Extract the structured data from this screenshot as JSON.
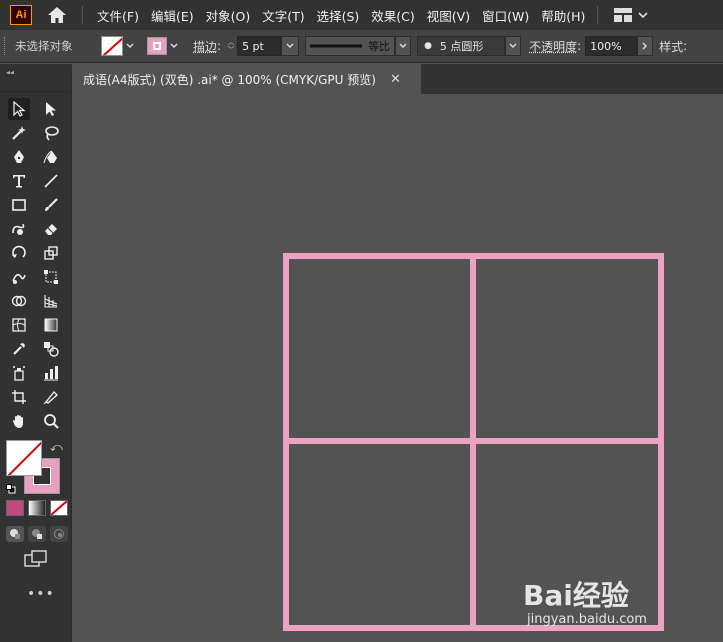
{
  "app": {
    "logo_text": "Ai"
  },
  "menu": {
    "items": [
      {
        "label": "文件(F)"
      },
      {
        "label": "编辑(E)"
      },
      {
        "label": "对象(O)"
      },
      {
        "label": "文字(T)"
      },
      {
        "label": "选择(S)"
      },
      {
        "label": "效果(C)"
      },
      {
        "label": "视图(V)"
      },
      {
        "label": "窗口(W)"
      },
      {
        "label": "帮助(H)"
      }
    ]
  },
  "control": {
    "selection_status": "未选择对象",
    "stroke_label": "描边",
    "stroke_colon": ":",
    "stroke_weight": "5 pt",
    "profile_label": "等比",
    "brush_label": "5 点圆形",
    "opacity_label": "不透明度",
    "opacity_colon": ":",
    "opacity_value": "100%",
    "style_label": "样式",
    "style_colon": ":"
  },
  "document": {
    "tab_title": "成语(A4版式)  (双色) .ai* @ 100% (CMYK/GPU 预览)",
    "close_glyph": "✕"
  },
  "toolbar": {
    "more_glyph": "•••"
  },
  "colors": {
    "stroke_pink": "#e8a0c0",
    "canvas": "#535353",
    "panel": "#323232",
    "none_red": "#dd0000"
  },
  "artwork": {
    "description_shape": "2x2 grid of squares",
    "stroke_color": "#eea2c2"
  },
  "watermark": {
    "logo_text": "Bai经验",
    "url": "jingyan.baidu.com"
  }
}
